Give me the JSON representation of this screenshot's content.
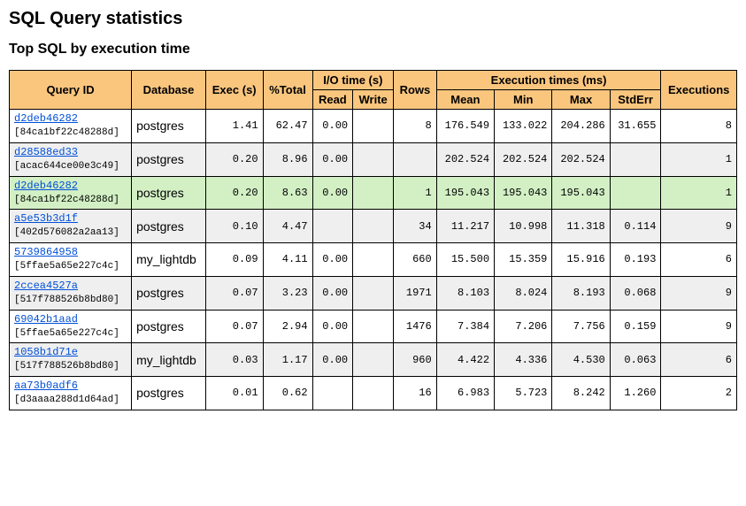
{
  "titles": {
    "main": "SQL Query statistics",
    "sub": "Top SQL by execution time"
  },
  "headers": {
    "query_id": "Query ID",
    "database": "Database",
    "exec_s": "Exec (s)",
    "pct_total": "%Total",
    "io_time_s": "I/O time (s)",
    "read": "Read",
    "write": "Write",
    "rows": "Rows",
    "exec_times_ms": "Execution times (ms)",
    "mean": "Mean",
    "min": "Min",
    "max": "Max",
    "stderr": "StdErr",
    "executions": "Executions"
  },
  "rows": [
    {
      "qid": "d2deb46282",
      "qhash": "[84ca1bf22c48288d]",
      "db": "postgres",
      "exec_s": "1.41",
      "pct": "62.47",
      "read": "0.00",
      "write": "",
      "rows": "8",
      "mean": "176.549",
      "min": "133.022",
      "max": "204.286",
      "stderr": "31.655",
      "execs": "8",
      "rowcls": ""
    },
    {
      "qid": "d28588ed33",
      "qhash": "[acac644ce00e3c49]",
      "db": "postgres",
      "exec_s": "0.20",
      "pct": "8.96",
      "read": "0.00",
      "write": "",
      "rows": "",
      "mean": "202.524",
      "min": "202.524",
      "max": "202.524",
      "stderr": "",
      "execs": "1",
      "rowcls": "row-alt"
    },
    {
      "qid": "d2deb46282",
      "qhash": "[84ca1bf22c48288d]",
      "db": "postgres",
      "exec_s": "0.20",
      "pct": "8.63",
      "read": "0.00",
      "write": "",
      "rows": "1",
      "mean": "195.043",
      "min": "195.043",
      "max": "195.043",
      "stderr": "",
      "execs": "1",
      "rowcls": "row-hl"
    },
    {
      "qid": "a5e53b3d1f",
      "qhash": "[402d576082a2aa13]",
      "db": "postgres",
      "exec_s": "0.10",
      "pct": "4.47",
      "read": "",
      "write": "",
      "rows": "34",
      "mean": "11.217",
      "min": "10.998",
      "max": "11.318",
      "stderr": "0.114",
      "execs": "9",
      "rowcls": "row-alt"
    },
    {
      "qid": "5739864958",
      "qhash": "[5ffae5a65e227c4c]",
      "db": "my_lightdb",
      "exec_s": "0.09",
      "pct": "4.11",
      "read": "0.00",
      "write": "",
      "rows": "660",
      "mean": "15.500",
      "min": "15.359",
      "max": "15.916",
      "stderr": "0.193",
      "execs": "6",
      "rowcls": ""
    },
    {
      "qid": "2ccea4527a",
      "qhash": "[517f788526b8bd80]",
      "db": "postgres",
      "exec_s": "0.07",
      "pct": "3.23",
      "read": "0.00",
      "write": "",
      "rows": "1971",
      "mean": "8.103",
      "min": "8.024",
      "max": "8.193",
      "stderr": "0.068",
      "execs": "9",
      "rowcls": "row-alt"
    },
    {
      "qid": "69042b1aad",
      "qhash": "[5ffae5a65e227c4c]",
      "db": "postgres",
      "exec_s": "0.07",
      "pct": "2.94",
      "read": "0.00",
      "write": "",
      "rows": "1476",
      "mean": "7.384",
      "min": "7.206",
      "max": "7.756",
      "stderr": "0.159",
      "execs": "9",
      "rowcls": ""
    },
    {
      "qid": "1058b1d71e",
      "qhash": "[517f788526b8bd80]",
      "db": "my_lightdb",
      "exec_s": "0.03",
      "pct": "1.17",
      "read": "0.00",
      "write": "",
      "rows": "960",
      "mean": "4.422",
      "min": "4.336",
      "max": "4.530",
      "stderr": "0.063",
      "execs": "6",
      "rowcls": "row-alt"
    },
    {
      "qid": "aa73b0adf6",
      "qhash": "[d3aaaa288d1d64ad]",
      "db": "postgres",
      "exec_s": "0.01",
      "pct": "0.62",
      "read": "",
      "write": "",
      "rows": "16",
      "mean": "6.983",
      "min": "5.723",
      "max": "8.242",
      "stderr": "1.260",
      "execs": "2",
      "rowcls": ""
    }
  ],
  "chart_data": {
    "type": "table",
    "title": "Top SQL by execution time",
    "columns": [
      "Query ID",
      "Database",
      "Exec (s)",
      "%Total",
      "I/O Read",
      "I/O Write",
      "Rows",
      "Mean (ms)",
      "Min (ms)",
      "Max (ms)",
      "StdErr (ms)",
      "Executions"
    ],
    "rows": [
      [
        "d2deb46282",
        "postgres",
        1.41,
        62.47,
        0.0,
        null,
        8,
        176.549,
        133.022,
        204.286,
        31.655,
        8
      ],
      [
        "d28588ed33",
        "postgres",
        0.2,
        8.96,
        0.0,
        null,
        null,
        202.524,
        202.524,
        202.524,
        null,
        1
      ],
      [
        "d2deb46282",
        "postgres",
        0.2,
        8.63,
        0.0,
        null,
        1,
        195.043,
        195.043,
        195.043,
        null,
        1
      ],
      [
        "a5e53b3d1f",
        "postgres",
        0.1,
        4.47,
        null,
        null,
        34,
        11.217,
        10.998,
        11.318,
        0.114,
        9
      ],
      [
        "5739864958",
        "my_lightdb",
        0.09,
        4.11,
        0.0,
        null,
        660,
        15.5,
        15.359,
        15.916,
        0.193,
        6
      ],
      [
        "2ccea4527a",
        "postgres",
        0.07,
        3.23,
        0.0,
        null,
        1971,
        8.103,
        8.024,
        8.193,
        0.068,
        9
      ],
      [
        "69042b1aad",
        "postgres",
        0.07,
        2.94,
        0.0,
        null,
        1476,
        7.384,
        7.206,
        7.756,
        0.159,
        9
      ],
      [
        "1058b1d71e",
        "my_lightdb",
        0.03,
        1.17,
        0.0,
        null,
        960,
        4.422,
        4.336,
        4.53,
        0.063,
        6
      ],
      [
        "aa73b0adf6",
        "postgres",
        0.01,
        0.62,
        null,
        null,
        16,
        6.983,
        5.723,
        8.242,
        1.26,
        2
      ]
    ]
  }
}
